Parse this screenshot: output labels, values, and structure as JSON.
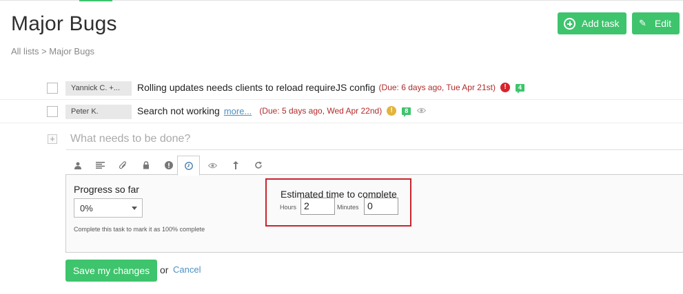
{
  "page": {
    "title": "Major Bugs",
    "breadcrumb": {
      "root": "All lists",
      "separator": ">",
      "current": "Major Bugs"
    }
  },
  "header_actions": {
    "add_task_label": "Add task",
    "edit_label": "Edit"
  },
  "tasks": [
    {
      "assignee": "Yannick C. +...",
      "text": "Rolling updates needs clients to reload requireJS config",
      "more_link": "",
      "due": "(Due: 6 days ago, Tue Apr 21st)",
      "priority": "!",
      "priority_color": "#d9232a",
      "comments": "4"
    },
    {
      "assignee": "Peter K.",
      "text": "Search not working",
      "more_link": "more...",
      "due": "(Due: 5 days ago, Wed Apr 22nd)",
      "priority": "!",
      "priority_color": "#e3b43a",
      "comments": "8"
    }
  ],
  "new_task": {
    "placeholder": "What needs to be done?"
  },
  "editor_tabs": [
    {
      "icon": "person-icon"
    },
    {
      "icon": "notes-icon"
    },
    {
      "icon": "paperclip-icon"
    },
    {
      "icon": "lock-icon"
    },
    {
      "icon": "priority-icon"
    },
    {
      "icon": "clock-icon",
      "active": true
    },
    {
      "icon": "eye-icon"
    },
    {
      "icon": "move-up-icon"
    },
    {
      "icon": "repeat-icon"
    }
  ],
  "progress": {
    "label": "Progress so far",
    "value": "0%",
    "hint": "Complete this task to mark it as 100% complete"
  },
  "estimate": {
    "label": "Estimated time to complete",
    "hours_label": "Hours",
    "hours_value": "2",
    "minutes_label": "Minutes",
    "minutes_value": "0"
  },
  "form_actions": {
    "save_label": "Save my changes",
    "or_text": "or",
    "cancel_label": "Cancel"
  },
  "colors": {
    "accent_green": "#3ec46d",
    "due_red": "#b02a2a",
    "highlight_red": "#c8232a",
    "link_blue": "#4a90c2"
  }
}
